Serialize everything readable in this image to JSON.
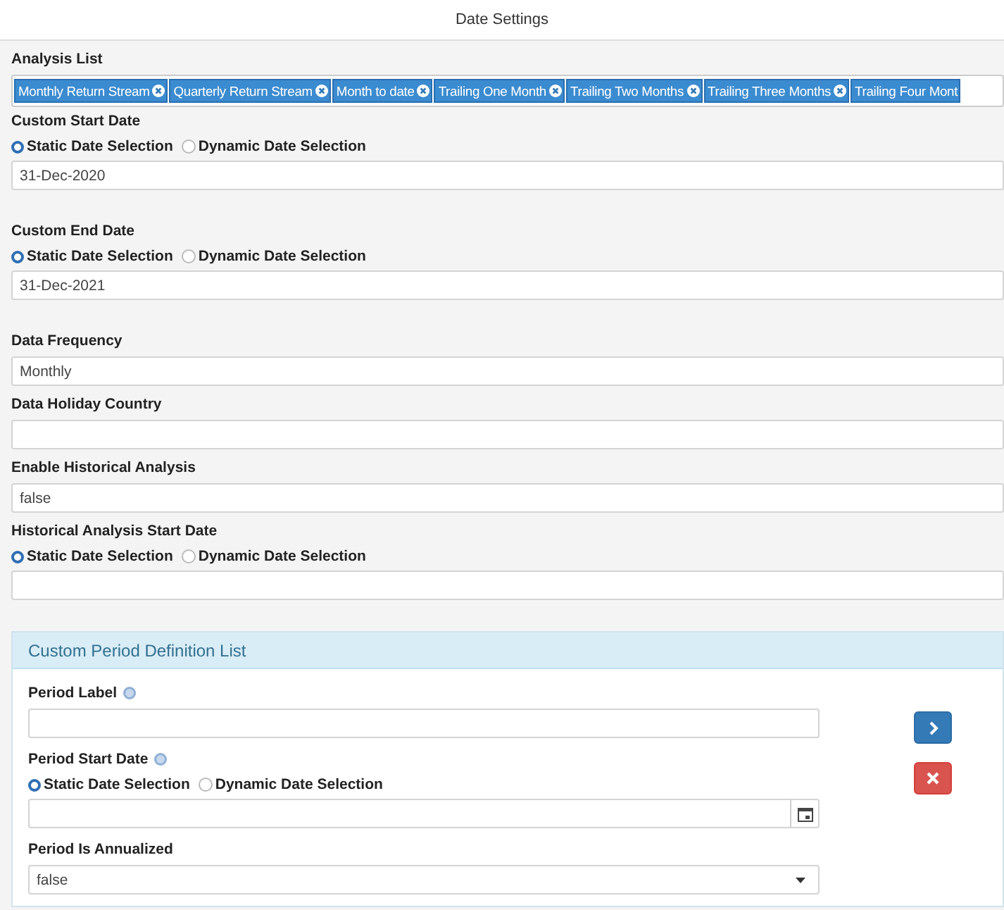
{
  "window": {
    "title": "Date Settings"
  },
  "fields": [
    {
      "kind": "tags",
      "label": "Analysis List",
      "tags": [
        {
          "text": "Monthly Return Stream",
          "removable": true
        },
        {
          "text": "Quarterly Return Stream",
          "removable": true
        },
        {
          "text": "Month to date",
          "removable": true
        },
        {
          "text": "Trailing One Month",
          "removable": true
        },
        {
          "text": "Trailing Two Months",
          "removable": true
        },
        {
          "text": "Trailing Three Months",
          "removable": true
        },
        {
          "text": "Trailing Four Mont",
          "removable": false
        }
      ]
    },
    {
      "kind": "date",
      "label": "Custom Start Date",
      "options": [
        {
          "label": "Static Date Selection",
          "selected": true
        },
        {
          "label": "Dynamic Date Selection",
          "selected": false
        }
      ],
      "value": "31-Dec-2020"
    },
    {
      "kind": "date",
      "label": "Custom End Date",
      "options": [
        {
          "label": "Static Date Selection",
          "selected": true
        },
        {
          "label": "Dynamic Date Selection",
          "selected": false
        }
      ],
      "value": "31-Dec-2021"
    },
    {
      "kind": "text",
      "label": "Data Frequency",
      "value": "Monthly"
    },
    {
      "kind": "text",
      "label": "Data Holiday Country"
    },
    {
      "kind": "text",
      "label": "Enable Historical Analysis",
      "value": "false"
    },
    {
      "kind": "date",
      "label": "Historical Analysis Start Date",
      "options": [
        {
          "label": "Static Date Selection",
          "selected": true
        },
        {
          "label": "Dynamic Date Selection",
          "selected": false
        }
      ]
    }
  ],
  "panel": {
    "title": "Custom Period Definition List",
    "fields": [
      {
        "kind": "text",
        "label": "Period Label",
        "help": true
      },
      {
        "kind": "date",
        "label": "Period Start Date",
        "help": true,
        "calendar": true,
        "options": [
          {
            "label": "Static Date Selection",
            "selected": true
          },
          {
            "label": "Dynamic Date Selection",
            "selected": false
          }
        ]
      },
      {
        "kind": "select",
        "label": "Period Is Annualized",
        "value": "false"
      }
    ],
    "buttons": [
      {
        "kind": "next"
      },
      {
        "kind": "remove"
      }
    ]
  }
}
